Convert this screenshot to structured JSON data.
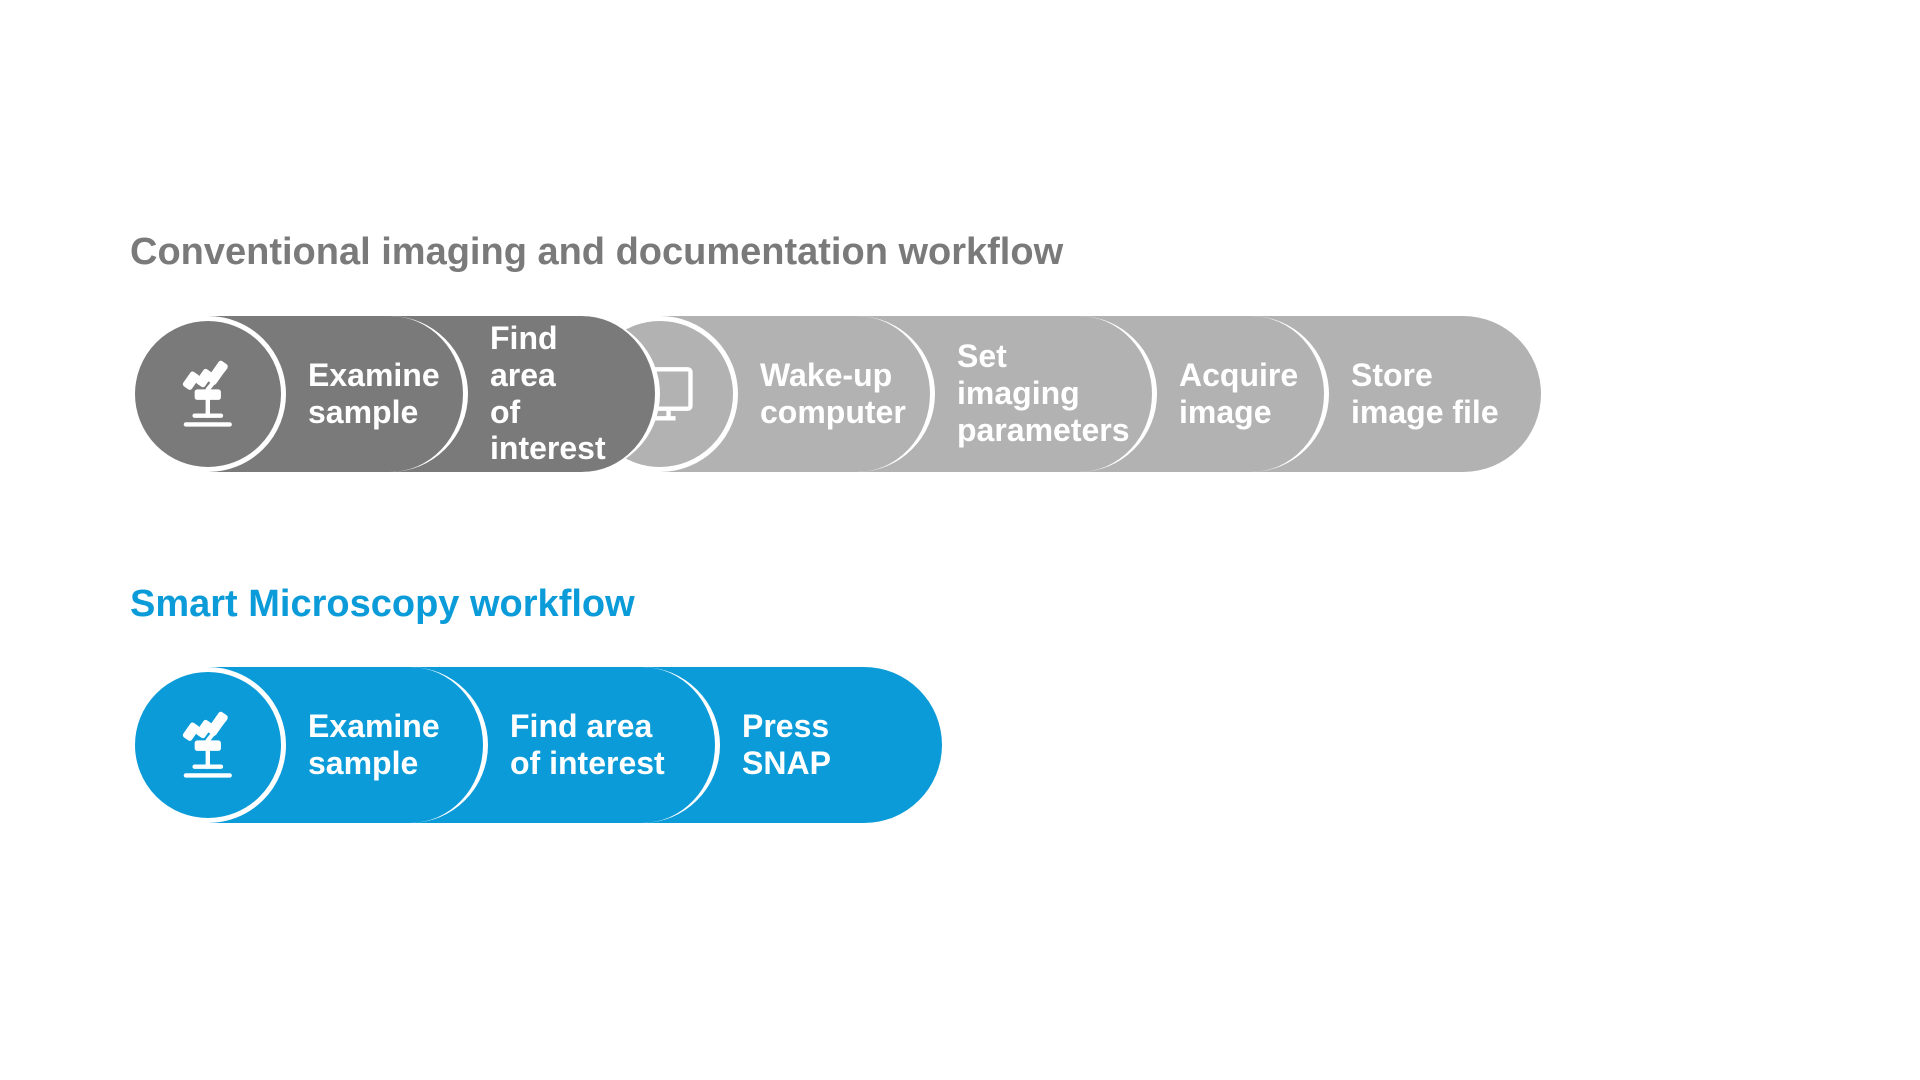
{
  "conventional": {
    "title": "Conventional imaging and documentation workflow",
    "steps": {
      "examine": "Examine\nsample",
      "find": "Find area\nof interest",
      "wakeup": "Wake-up\ncomputer",
      "setparams": "Set imaging\nparameters",
      "acquire": "Acquire\nimage",
      "store": "Store\nimage file"
    }
  },
  "smart": {
    "title": "Smart Microscopy workflow",
    "steps": {
      "examine": "Examine\nsample",
      "find": "Find area\nof interest",
      "snap": "Press\nSNAP"
    }
  },
  "colors": {
    "gray_dark": "#7a7a7a",
    "gray_mid": "#b2b2b2",
    "blue": "#0a9bd8"
  }
}
